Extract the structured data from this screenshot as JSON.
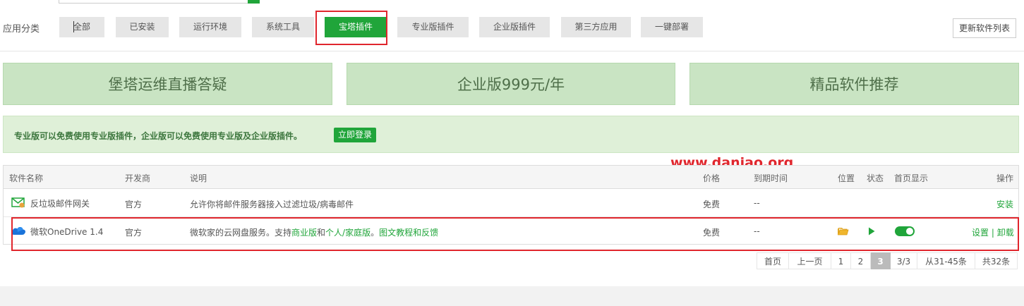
{
  "category": {
    "label": "应用分类",
    "items": [
      "全部",
      "已安装",
      "运行环境",
      "系统工具",
      "宝塔插件",
      "专业版插件",
      "企业版插件",
      "第三方应用",
      "一键部署"
    ],
    "active": "宝塔插件",
    "refresh_label": "更新软件列表"
  },
  "banners": [
    "堡塔运维直播答疑",
    "企业版999元/年",
    "精品软件推荐"
  ],
  "alert": {
    "text": "专业版可以免费使用专业版插件，企业版可以免费使用专业版及企业版插件。",
    "button": "立即登录"
  },
  "watermark": "www.daniao.org",
  "table": {
    "headers": [
      "软件名称",
      "开发商",
      "说明",
      "价格",
      "到期时间",
      "位置",
      "状态",
      "首页显示",
      "操作"
    ],
    "rows": [
      {
        "icon": "mail-shield-icon",
        "name": "反垃圾邮件网关",
        "developer": "官方",
        "desc": "允许你将邮件服务器接入过滤垃圾/病毒邮件",
        "price": "免费",
        "expire": "--",
        "action": "安装"
      },
      {
        "icon": "onedrive-cloud-icon",
        "name": "微软OneDrive 1.4",
        "developer": "官方",
        "desc_prefix": "微软家的云网盘服务。支持",
        "desc_link1": "商业版",
        "desc_and": "和",
        "desc_link2": "个人/家庭版",
        "desc_sep": "。",
        "desc_link3": "图文教程和反馈",
        "price": "免费",
        "expire": "--",
        "position_icon": "folder-icon",
        "status_icon": "play-icon",
        "home_display": true,
        "action_settings": "设置",
        "action_sep": "|",
        "action_uninstall": "卸载"
      }
    ]
  },
  "pager": {
    "items": [
      "首页",
      "上一页",
      "1",
      "2",
      "3",
      "3/3",
      "从31-45条",
      "共32条"
    ],
    "current": "3"
  },
  "colors": {
    "accent": "#20a53a",
    "highlight": "#e0262d",
    "banner_bg": "#c9e4c3",
    "alert_bg": "#dff0d8"
  }
}
